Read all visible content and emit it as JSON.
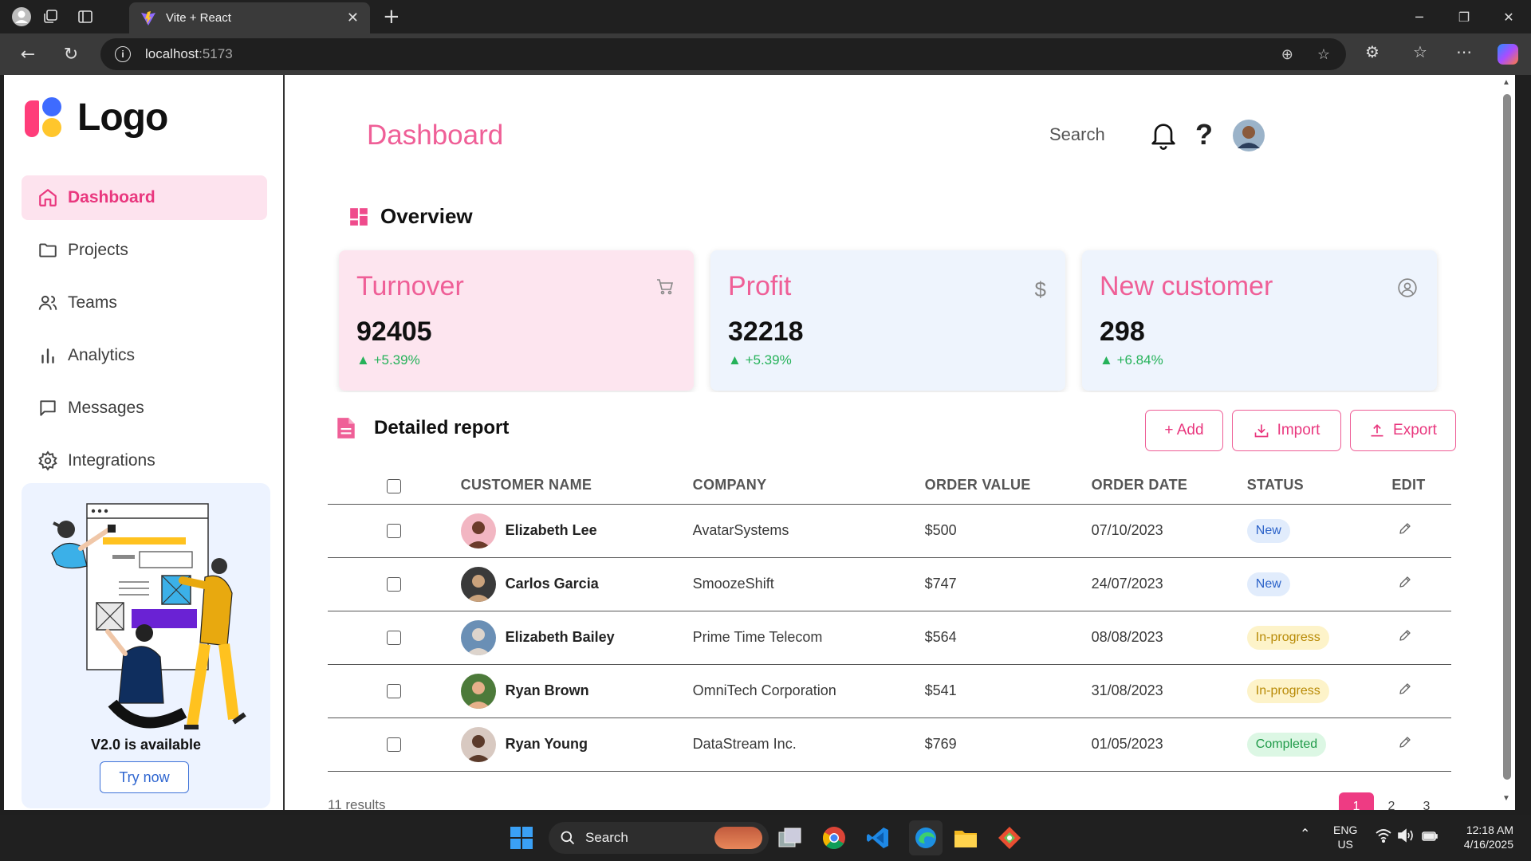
{
  "browser": {
    "tab_title": "Vite + React",
    "url_host": "localhost",
    "url_port": ":5173"
  },
  "sidebar": {
    "logo_text": "Logo",
    "items": [
      {
        "label": "Dashboard",
        "icon": "home-icon",
        "active": true
      },
      {
        "label": "Projects",
        "icon": "folder-icon",
        "active": false
      },
      {
        "label": "Teams",
        "icon": "users-icon",
        "active": false
      },
      {
        "label": "Analytics",
        "icon": "bar-chart-icon",
        "active": false
      },
      {
        "label": "Messages",
        "icon": "message-square-icon",
        "active": false
      },
      {
        "label": "Integrations",
        "icon": "settings-icon",
        "active": false
      }
    ],
    "promo": {
      "title": "V2.0 is available",
      "button": "Try now"
    }
  },
  "header": {
    "title": "Dashboard",
    "search_label": "Search"
  },
  "overview": {
    "title": "Overview",
    "cards": [
      {
        "title": "Turnover",
        "value": "92405",
        "delta": "+5.39%",
        "icon": "shopping-cart-icon",
        "bg": "#fde5ef"
      },
      {
        "title": "Profit",
        "value": "32218",
        "delta": "+5.39%",
        "icon": "dollar-icon",
        "bg": "#eef4fd"
      },
      {
        "title": "New customer",
        "value": "298",
        "delta": "+6.84%",
        "icon": "user-circle-icon",
        "bg": "#eef4fd"
      }
    ]
  },
  "report": {
    "title": "Detailed report",
    "buttons": {
      "add": "+ Add",
      "import": "Import",
      "export": "Export"
    },
    "columns": [
      "CUSTOMER NAME",
      "COMPANY",
      "ORDER VALUE",
      "ORDER DATE",
      "STATUS",
      "EDIT"
    ],
    "rows": [
      {
        "name": "Elizabeth Lee",
        "company": "AvatarSystems",
        "value": "$500",
        "date": "07/10/2023",
        "status": "New"
      },
      {
        "name": "Carlos Garcia",
        "company": "SmoozeShift",
        "value": "$747",
        "date": "24/07/2023",
        "status": "New"
      },
      {
        "name": "Elizabeth Bailey",
        "company": "Prime Time Telecom",
        "value": "$564",
        "date": "08/08/2023",
        "status": "In-progress"
      },
      {
        "name": "Ryan Brown",
        "company": "OmniTech Corporation",
        "value": "$541",
        "date": "31/08/2023",
        "status": "In-progress"
      },
      {
        "name": "Ryan Young",
        "company": "DataStream Inc.",
        "value": "$769",
        "date": "01/05/2023",
        "status": "Completed"
      }
    ],
    "results_text": "11 results",
    "pages": [
      "1",
      "2",
      "3"
    ],
    "current_page": "1"
  },
  "status_colors": {
    "New": {
      "bg": "#e1ecfc",
      "fg": "#2c63c9"
    },
    "In-progress": {
      "bg": "#fdf3c9",
      "fg": "#b88a06"
    },
    "Completed": {
      "bg": "#dcf7e4",
      "fg": "#1f9a48"
    }
  },
  "taskbar": {
    "search_label": "Search",
    "lang_1": "ENG",
    "lang_2": "US",
    "time": "12:18 AM",
    "date": "4/16/2025"
  }
}
